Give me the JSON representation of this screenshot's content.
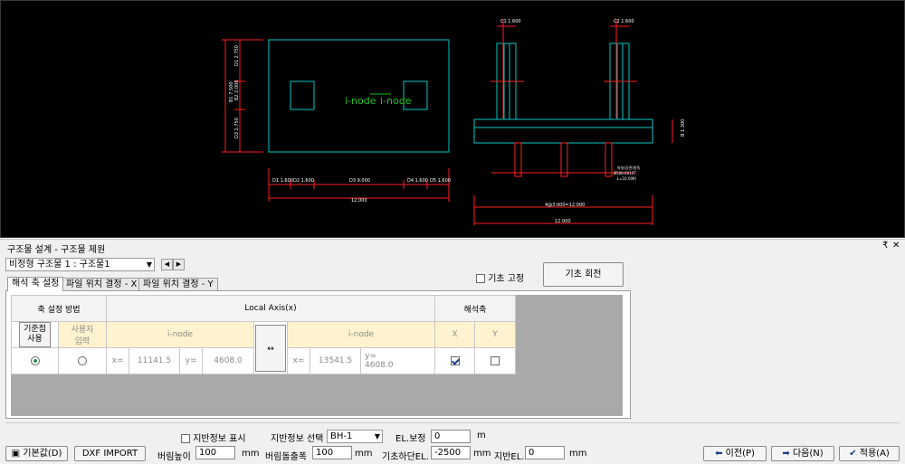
{
  "cad": {
    "plan_labels": [
      "i-node",
      "i-node"
    ],
    "dim_left": [
      "D1 2.750",
      "B2 2.000",
      "D3 2.750",
      "B1 7.500"
    ],
    "dim_bottom_a": [
      "D1 1.600",
      "D2 1.600",
      "D3 9.000",
      "D4 1.600",
      "D5 1.600"
    ],
    "dim_bottom_total": "12.000",
    "col_labels": [
      "C1 1.600",
      "C2 1.600"
    ],
    "section_right": "B 1.300",
    "pile_note": [
      "파일(강관)말뚝",
      "Ø508.0X12T,",
      "L=10.0(M)"
    ],
    "section_dims": [
      "4@3.000=12.000",
      "12.000"
    ]
  },
  "panel": {
    "title": "구조물 설계 - 구조물 제원",
    "pin": "₹",
    "close": "✕"
  },
  "structure_select": {
    "value": "비정형 구조물 1 : 구조물1"
  },
  "fix_base": {
    "label": "기초 고정",
    "checked": false
  },
  "rotate_button": "기초 회전",
  "tabs": [
    "해석 축 설정",
    "파일 위치 결정 - X",
    "파일 위치 결정 - Y"
  ],
  "axis_table": {
    "method_header": "축 설정 방법",
    "local_axis_header": "Local Axis(x)",
    "analysis_header": "해석축",
    "base_point_btn": "기준점\n사용",
    "user_input": "사용자\n입력",
    "i_node_1": "i-node",
    "i_node_2": "i-node",
    "swap_icon": "↔",
    "col_x": "X",
    "col_y": "Y",
    "x_label": "x=",
    "y_label": "y=",
    "x1": "11141.5",
    "y1": "4608.0",
    "x2": "13541.5",
    "y2": "4608.0",
    "analysis_x": true,
    "analysis_y": false,
    "mode": "base"
  },
  "ground": {
    "show_label": "지반정보 표시",
    "select_label": "지반정보 선택",
    "select_value": "BH-1",
    "el_label": "EL.보정",
    "el_value": "0",
    "el_unit": "m"
  },
  "footer": {
    "default_btn": "기본값(D)",
    "dxf_btn": "DXF IMPORT",
    "berim_height_label": "버림높이",
    "berim_height_value": "100",
    "berim_height_unit": "mm",
    "berim_width_label": "버림돌출폭",
    "berim_width_value": "100",
    "berim_width_unit": "mm",
    "base_el_label": "기초하단EL.",
    "base_el_value": "-2500",
    "base_el_unit": "mm",
    "ground_el_label": "지반EL.",
    "ground_el_value": "0",
    "ground_el_unit": "mm",
    "prev_btn": "이전(P)",
    "next_btn": "다음(N)",
    "apply_btn": "적용(A)"
  },
  "colors": {
    "cyan": "#00c8c8",
    "red": "#ff2020",
    "green": "#20c020",
    "cad_bg": "#000000"
  }
}
